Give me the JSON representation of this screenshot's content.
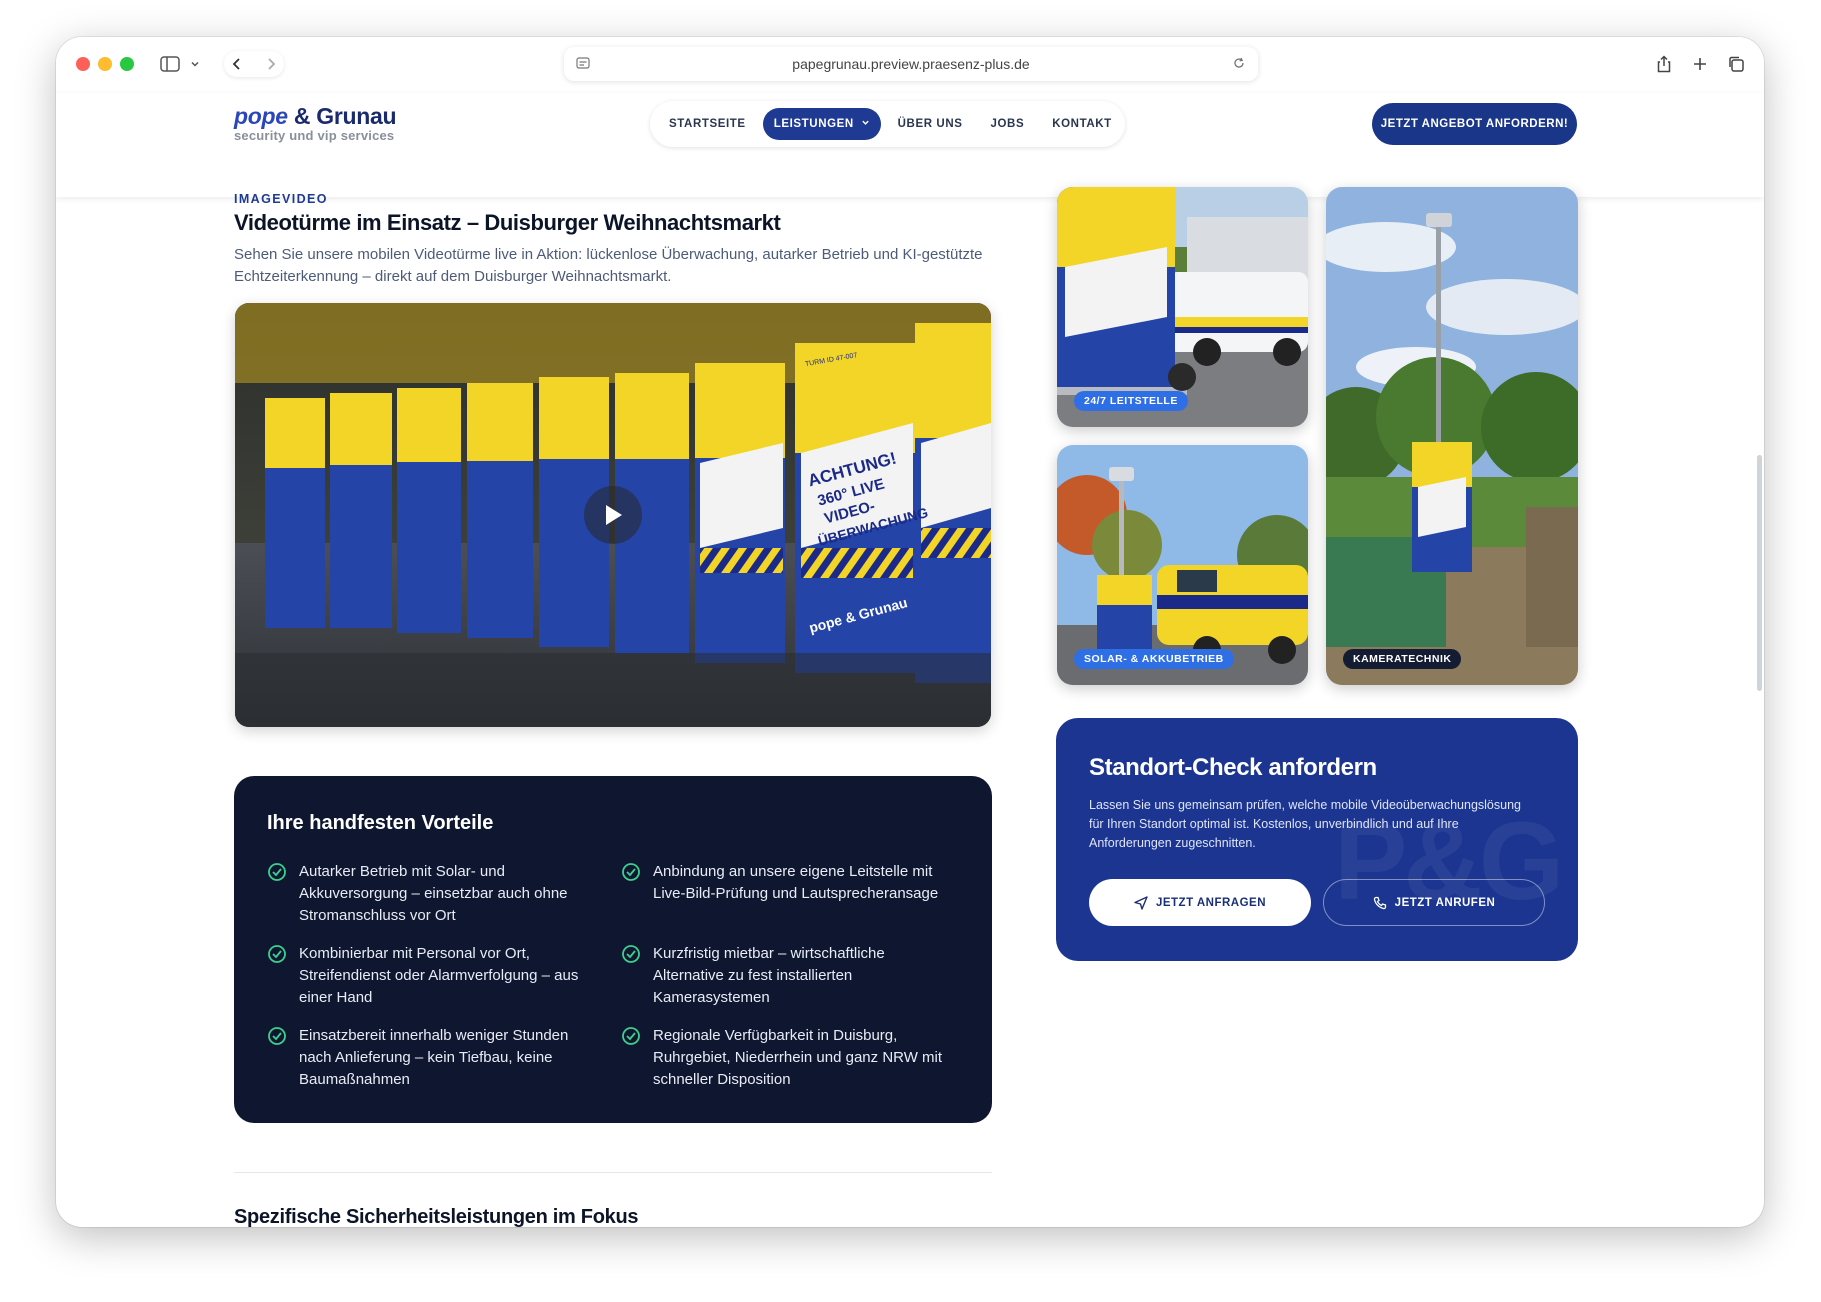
{
  "browser": {
    "url": "papegrunau.preview.praesenz-plus.de"
  },
  "logo": {
    "brand_left": "pope",
    "brand_right": "& Grunau",
    "tagline": "security und vip services"
  },
  "nav": {
    "items": [
      {
        "label": "STARTSEITE"
      },
      {
        "label": "LEISTUNGEN"
      },
      {
        "label": "ÜBER UNS"
      },
      {
        "label": "JOBS"
      },
      {
        "label": "KONTAKT"
      }
    ],
    "cta_label": "JETZT ANGEBOT ANFORDERN!"
  },
  "video_section": {
    "eyebrow": "IMAGEVIDEO",
    "title": "Videotürme im Einsatz – Duisburger Weihnachtsmarkt",
    "description": "Sehen Sie unsere mobilen Videotürme live in Aktion: lückenlose Überwachung, autarker Betrieb und KI-gestützte Echtzeiterkennung – direkt auf dem Duisburger Weihnachtsmarkt.",
    "tower_text": {
      "line1": "ACHTUNG!",
      "line2": "360° LIVE",
      "line3": "VIDEO-",
      "line4": "ÜBERWACHUNG",
      "brand": "pope & Grunau",
      "id": "TURM ID 47-007"
    }
  },
  "advantages": {
    "title": "Ihre handfesten Vorteile",
    "items": [
      "Autarker Betrieb mit Solar- und Akkuversorgung – einsetzbar auch ohne Stromanschluss vor Ort",
      "Anbindung an unsere eigene Leitstelle mit Live-Bild-Prüfung und Lautsprecheransage",
      "Kombinierbar mit Personal vor Ort, Streifendienst oder Alarmverfolgung – aus einer Hand",
      "Kurzfristig mietbar – wirtschaftliche Alternative zu fest installierten Kamerasystemen",
      "Einsatzbereit innerhalb weniger Stunden nach Anlieferung – kein Tiefbau, keine Baumaßnahmen",
      "Regionale Verfügbarkeit in Duisburg, Ruhrgebiet, Niederrhein und ganz NRW mit schneller Disposition"
    ]
  },
  "next_section": {
    "title": "Spezifische Sicherheitsleistungen im Fokus"
  },
  "gallery": {
    "tiles": [
      {
        "badge": "24/7 LEITSTELLE"
      },
      {
        "badge": "SOLAR- & AKKUBETRIEB"
      },
      {
        "badge": "KAMERATECHNIK"
      }
    ]
  },
  "cta_card": {
    "title": "Standort-Check anfordern",
    "text": "Lassen Sie uns gemeinsam prüfen, welche mobile Videoüberwachungslösung für Ihren Standort optimal ist. Kostenlos, unverbindlich und auf Ihre Anforderungen zugeschnitten.",
    "btn_primary": "JETZT ANFRAGEN",
    "btn_secondary": "JETZT ANRUFEN",
    "watermark": "P&G"
  },
  "colors": {
    "brand_blue": "#1f3a93",
    "dark_navy": "#0f1730",
    "badge_blue": "#2f6fe6",
    "check_green": "#3ecf8e"
  }
}
